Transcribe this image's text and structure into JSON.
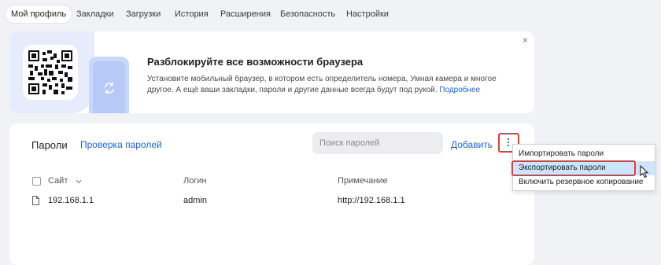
{
  "tabs": [
    {
      "label": "Мой профиль",
      "active": true
    },
    {
      "label": "Закладки"
    },
    {
      "label": "Загрузки"
    },
    {
      "label": "История"
    },
    {
      "label": "Расширения"
    },
    {
      "label": "Безопасность"
    },
    {
      "label": "Настройки"
    }
  ],
  "promo": {
    "title": "Разблокируйте все возможности браузера",
    "text": "Установите мобильный браузер, в котором есть определитель номера, Умная камера и многое другое. А ещё ваши закладки, пароли и другие данные всегда будут под рукой.",
    "link": "Подробнее",
    "close": "×"
  },
  "passwords": {
    "title": "Пароли",
    "check_link": "Проверка паролей",
    "search_placeholder": "Поиск паролей",
    "add_label": "Добавить",
    "columns": {
      "site": "Сайт",
      "login": "Логин",
      "note": "Примечание"
    },
    "rows": [
      {
        "site": "192.168.1.1",
        "login": "admin",
        "note": "http://192.168.1.1"
      }
    ]
  },
  "menu": {
    "items": [
      {
        "label": "Импортировать пароли"
      },
      {
        "label": "Экспортировать пароли",
        "highlighted": true
      },
      {
        "label": "Включить резервное копирование"
      }
    ]
  },
  "colors": {
    "accent": "#1a66d9",
    "annotation": "#e23c3c",
    "page_bg": "#f1f2f5",
    "menu_highlight": "#cfe3fb"
  }
}
